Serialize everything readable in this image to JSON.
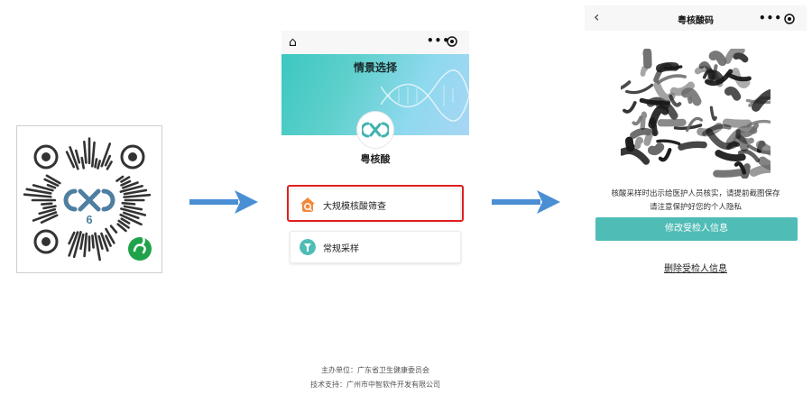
{
  "qr": {
    "number": "6"
  },
  "phone1": {
    "header_title": "情景选择",
    "app_name": "粤核酸",
    "options": [
      {
        "label": "大规模核酸筛查",
        "icon": "house-scan-icon",
        "highlighted": true
      },
      {
        "label": "常规采样",
        "icon": "tube-icon",
        "highlighted": false
      }
    ],
    "footer": {
      "organizer": "主办单位：广东省卫生健康委员会",
      "support": "技术支持：广州市中智软件开发有限公司"
    }
  },
  "phone2": {
    "title": "粤核酸码",
    "notice_line1": "核酸采样时出示给医护人员核实，请提前截图保存",
    "notice_line2": "请注意保护好您的个人隐私",
    "modify_button": "修改受检人信息",
    "delete_link": "删除受检人信息"
  },
  "colors": {
    "arrow": "#4a8fd4",
    "teal": "#4fbcb6",
    "highlight": "#e02020",
    "orange": "#f08a3c"
  }
}
